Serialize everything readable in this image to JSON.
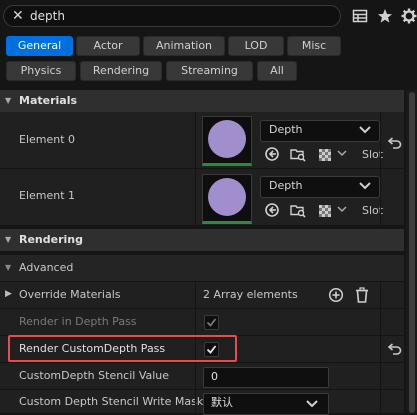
{
  "search": {
    "value": "depth"
  },
  "toolbar": {
    "icons": [
      "table-icon",
      "star-icon",
      "gear-icon"
    ]
  },
  "filters": {
    "row1": [
      "General",
      "Actor",
      "Animation",
      "LOD",
      "Misc"
    ],
    "row2": [
      "Physics",
      "Rendering",
      "Streaming",
      "All"
    ],
    "active": "General",
    "accent": "#0070e0"
  },
  "materials": {
    "header": "Materials",
    "elements": [
      {
        "label": "Element 0",
        "material": "Depth",
        "slot": "Slot"
      },
      {
        "label": "Element 1",
        "material": "Depth",
        "slot": "Slot"
      }
    ],
    "swatch_color": "#a08fcc"
  },
  "rendering": {
    "header": "Rendering",
    "advanced": "Advanced",
    "override_materials": {
      "label": "Override Materials",
      "value": "2 Array elements"
    },
    "render_in_depth_pass": {
      "label": "Render in Depth Pass",
      "checked": true
    },
    "render_custom_depth_pass": {
      "label": "Render CustomDepth Pass",
      "checked": true,
      "highlight": "#e05050"
    },
    "custom_depth_stencil_value": {
      "label": "CustomDepth Stencil Value",
      "value": "0"
    },
    "custom_depth_stencil_write_mask": {
      "label": "Custom Depth Stencil Write Mask",
      "value": "默认"
    }
  }
}
